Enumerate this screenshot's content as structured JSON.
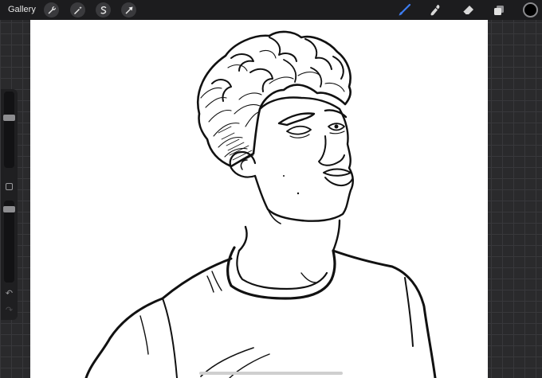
{
  "topbar": {
    "gallery_label": "Gallery",
    "left_tools": [
      "wrench-icon",
      "magic-wand-icon",
      "selection-icon",
      "transform-arrow-icon"
    ],
    "right_tools": [
      "brush-icon",
      "smudge-icon",
      "eraser-icon",
      "layers-icon"
    ],
    "active_tool": "brush-icon",
    "accent_color": "#3d7cf0",
    "current_color": "#000000"
  },
  "sidebar": {
    "brush_size_level": 0.82,
    "opacity_level": 0.92,
    "icons": [
      "modify-square-icon",
      "undo-icon",
      "redo-icon"
    ]
  },
  "canvas": {
    "background": "#ffffff",
    "content": "line-art-portrait"
  }
}
